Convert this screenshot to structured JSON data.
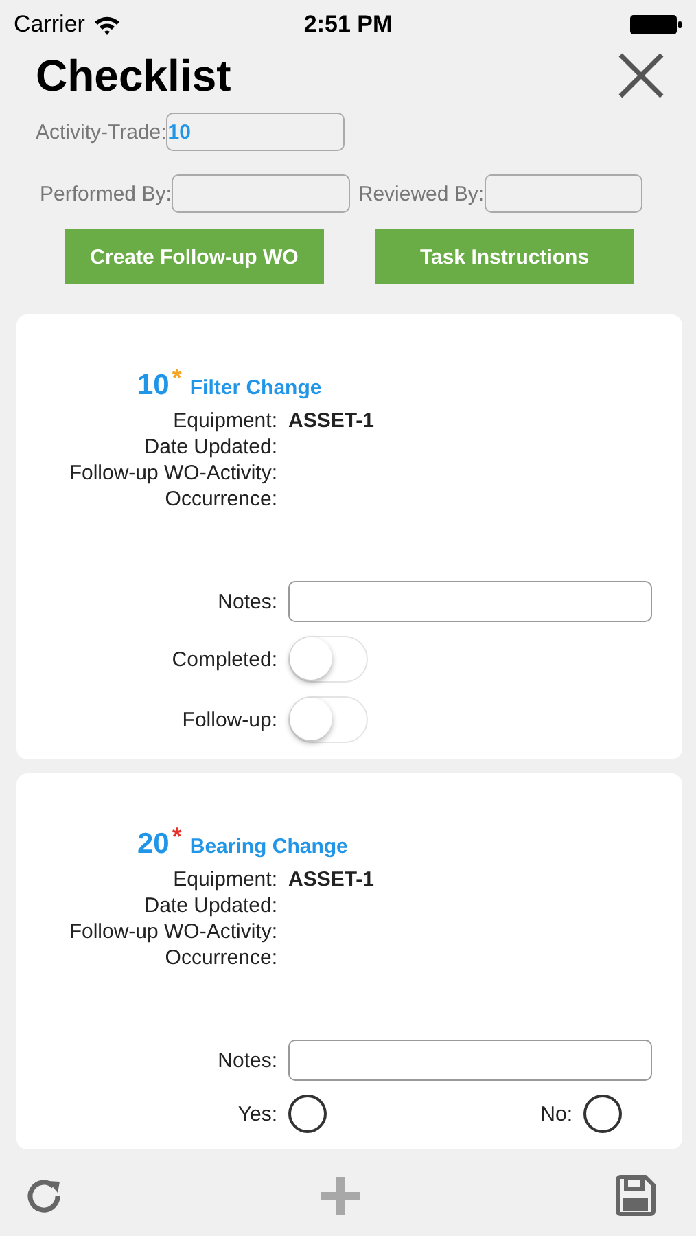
{
  "status_bar": {
    "carrier": "Carrier",
    "time": "2:51 PM"
  },
  "header": {
    "title": "Checklist"
  },
  "form": {
    "activity_trade": {
      "label": "Activity-Trade:",
      "value": "10"
    },
    "performed_by": {
      "label": "Performed By:"
    },
    "reviewed_by": {
      "label": "Reviewed By:"
    },
    "buttons": [
      "Create Follow-up WO",
      "Task Instructions"
    ]
  },
  "items": [
    {
      "number": "10",
      "required_mark": {
        "text": "*",
        "color": "#f5a623"
      },
      "title": "Filter Change",
      "fields": [
        {
          "label": "Equipment:",
          "value": "ASSET-1"
        },
        {
          "label": "Date Updated:"
        },
        {
          "label": "Follow-up WO-Activity:"
        },
        {
          "label": "Occurrence:"
        }
      ],
      "notes_label": "Notes:",
      "controls": [
        {
          "kind": "toggle",
          "label": "Completed:",
          "on": false
        },
        {
          "kind": "toggle",
          "label": "Follow-up:",
          "on": false
        }
      ]
    },
    {
      "number": "20",
      "required_mark": {
        "text": "*",
        "color": "#e8302a"
      },
      "title": "Bearing Change",
      "fields": [
        {
          "label": "Equipment:",
          "value": "ASSET-1"
        },
        {
          "label": "Date Updated:"
        },
        {
          "label": "Follow-up WO-Activity:"
        },
        {
          "label": "Occurrence:"
        }
      ],
      "notes_label": "Notes:",
      "controls": [
        {
          "kind": "radio",
          "options": [
            {
              "label": "Yes:",
              "selected": false
            },
            {
              "label": "No:",
              "selected": false
            }
          ]
        }
      ]
    }
  ],
  "toolbar": {
    "add_disabled": true
  }
}
